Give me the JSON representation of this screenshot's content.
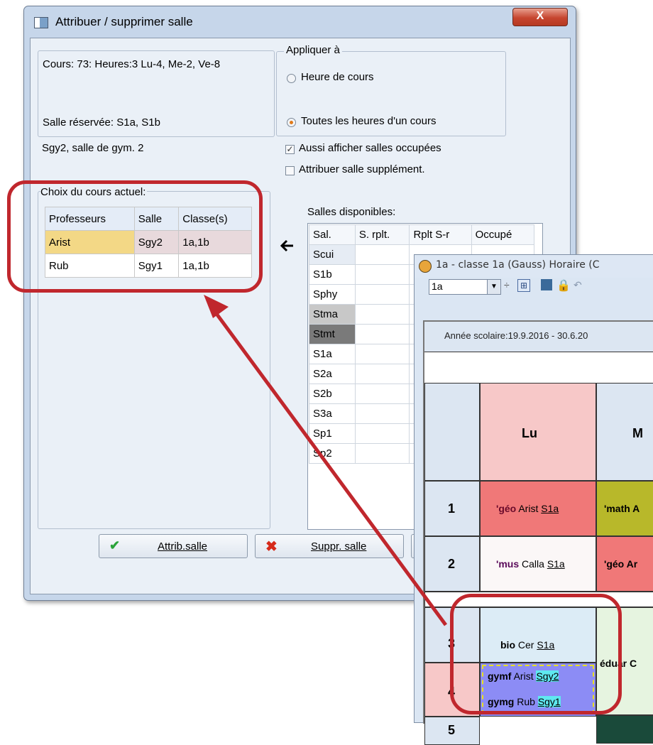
{
  "dialog": {
    "title": "Attribuer / supprimer salle",
    "close": "X",
    "cours_info": "Cours: 73: Heures:3 Lu-4, Me-2, Ve-8",
    "salle_reservee": "Salle réservée: S1a, S1b",
    "salle_desc": "Sgy2, salle de gym. 2",
    "appliquer": {
      "legend": "Appliquer à",
      "option1": "Heure de cours",
      "option2": "Toutes les heures d'un cours"
    },
    "check1": "Aussi afficher salles occupées",
    "check2": "Attribuer salle supplément.",
    "choix_label": "Choix du cours actuel:",
    "choix_headers": [
      "Professeurs",
      "Salle",
      "Classe(s)"
    ],
    "choix_rows": [
      {
        "prof": "Arist",
        "salle": "Sgy2",
        "classes": "1a,1b"
      },
      {
        "prof": "Rub",
        "salle": "Sgy1",
        "classes": "1a,1b"
      }
    ],
    "salles_label": "Salles disponibles:",
    "salles_headers": [
      "Sal.",
      "S. rplt.",
      "Rplt S-r",
      "Occupé"
    ],
    "salles": [
      "Scui",
      "S1b",
      "Sphy",
      "Stma",
      "Stmt",
      "S1a",
      "S2a",
      "S2b",
      "S3a",
      "Sp1",
      "Sp2"
    ],
    "btn_attrib": "Attrib.salle",
    "btn_suppr": "Suppr. salle"
  },
  "timetable": {
    "title": "1a - classe 1a (Gauss) Horaire (C",
    "class_select": "1a",
    "year": "Année scolaire:19.9.2016 - 30.6.20",
    "day_lu": "Lu",
    "day_m": "M",
    "p1": "1",
    "p2": "2",
    "p3": "3",
    "p4": "4",
    "p5": "5",
    "c1_sub": "'géo",
    "c1_teacher": "Arist",
    "c1_room": "S1a",
    "c1b": "'math A",
    "c2_sub": "'mus",
    "c2_teacher": "Calla",
    "c2_room": "S1a",
    "c2b": "'géo Ar",
    "c3_sub": "bio",
    "c3_teacher": "Cer",
    "c3_room": "S1a",
    "c3b": "éduar C",
    "c4a_sub": "gymf",
    "c4a_teacher": "Arist",
    "c4a_room": "Sgy2",
    "c4b_sub": "gymg",
    "c4b_teacher": "Rub",
    "c4b_room": "Sgy1"
  },
  "colors": {
    "highlight_red": "#c0272d",
    "selected_row": "#f3d886",
    "gym_cell": "#8c8cf5"
  }
}
